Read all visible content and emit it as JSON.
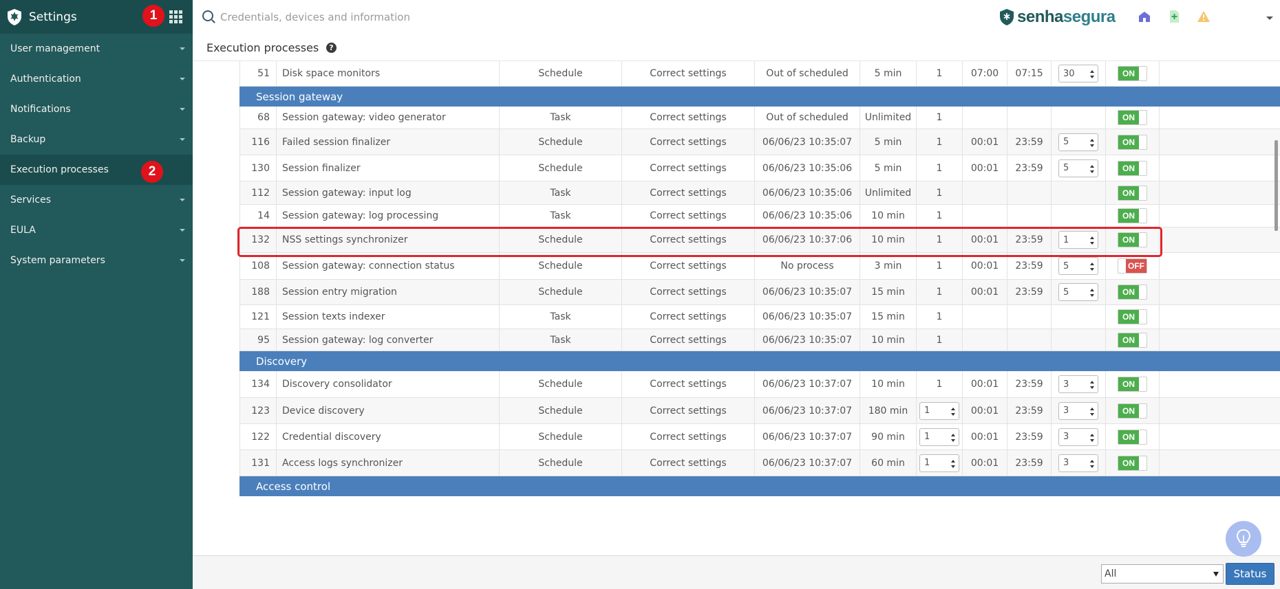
{
  "sidebar": {
    "title": "Settings",
    "badge1": "1",
    "badge2": "2",
    "items": [
      {
        "label": "User management",
        "caret": true
      },
      {
        "label": "Authentication",
        "caret": true
      },
      {
        "label": "Notifications",
        "caret": true
      },
      {
        "label": "Backup",
        "caret": true
      },
      {
        "label": "Execution processes",
        "caret": false,
        "active": true
      },
      {
        "label": "Services",
        "caret": true
      },
      {
        "label": "EULA",
        "caret": true
      },
      {
        "label": "System parameters",
        "caret": true
      }
    ]
  },
  "topbar": {
    "search_placeholder": "Credentials, devices and information",
    "brand_a": "senha",
    "brand_b": "segura"
  },
  "page": {
    "title": "Execution processes",
    "help": "?"
  },
  "table": {
    "rows": [
      {
        "kind": "row",
        "alt": false,
        "id": "51",
        "name": "Disk space monitors",
        "type": "Schedule",
        "status": "Correct settings",
        "last": "Out of scheduled",
        "interval": "5 min",
        "inst": "1",
        "inst_stepper": false,
        "start": "07:00",
        "end": "07:15",
        "num": "30",
        "toggle": "ON"
      },
      {
        "kind": "group",
        "label": "Session gateway"
      },
      {
        "kind": "row",
        "alt": false,
        "id": "68",
        "name": "Session gateway: video generator",
        "type": "Task",
        "status": "Correct settings",
        "last": "Out of scheduled",
        "interval": "Unlimited",
        "inst": "1",
        "inst_stepper": false,
        "start": "",
        "end": "",
        "num": "",
        "toggle": "ON"
      },
      {
        "kind": "row",
        "alt": true,
        "id": "116",
        "name": "Failed session finalizer",
        "type": "Schedule",
        "status": "Correct settings",
        "last": "06/06/23 10:35:07",
        "interval": "5 min",
        "inst": "1",
        "inst_stepper": false,
        "start": "00:01",
        "end": "23:59",
        "num": "5",
        "toggle": "ON"
      },
      {
        "kind": "row",
        "alt": false,
        "id": "130",
        "name": "Session finalizer",
        "type": "Schedule",
        "status": "Correct settings",
        "last": "06/06/23 10:35:06",
        "interval": "5 min",
        "inst": "1",
        "inst_stepper": false,
        "start": "00:01",
        "end": "23:59",
        "num": "5",
        "toggle": "ON"
      },
      {
        "kind": "row",
        "alt": true,
        "id": "112",
        "name": "Session gateway: input log",
        "type": "Task",
        "status": "Correct settings",
        "last": "06/06/23 10:35:06",
        "interval": "Unlimited",
        "inst": "1",
        "inst_stepper": false,
        "start": "",
        "end": "",
        "num": "",
        "toggle": "ON"
      },
      {
        "kind": "row",
        "alt": false,
        "id": "14",
        "name": "Session gateway: log processing",
        "type": "Task",
        "status": "Correct settings",
        "last": "06/06/23 10:35:06",
        "interval": "10 min",
        "inst": "1",
        "inst_stepper": false,
        "start": "",
        "end": "",
        "num": "",
        "toggle": "ON"
      },
      {
        "kind": "row",
        "alt": true,
        "id": "132",
        "name": "NSS settings synchronizer",
        "type": "Schedule",
        "status": "Correct settings",
        "last": "06/06/23 10:37:06",
        "interval": "10 min",
        "inst": "1",
        "inst_stepper": false,
        "start": "00:01",
        "end": "23:59",
        "num": "1",
        "toggle": "ON"
      },
      {
        "kind": "row",
        "alt": false,
        "id": "108",
        "name": "Session gateway: connection status",
        "type": "Schedule",
        "status": "Correct settings",
        "last": "No process",
        "interval": "3 min",
        "inst": "1",
        "inst_stepper": false,
        "start": "00:01",
        "end": "23:59",
        "num": "5",
        "toggle": "OFF"
      },
      {
        "kind": "row",
        "alt": true,
        "id": "188",
        "name": "Session entry migration",
        "type": "Schedule",
        "status": "Correct settings",
        "last": "06/06/23 10:35:07",
        "interval": "15 min",
        "inst": "1",
        "inst_stepper": false,
        "start": "00:01",
        "end": "23:59",
        "num": "5",
        "toggle": "ON"
      },
      {
        "kind": "row",
        "alt": false,
        "id": "121",
        "name": "Session texts indexer",
        "type": "Task",
        "status": "Correct settings",
        "last": "06/06/23 10:35:07",
        "interval": "15 min",
        "inst": "1",
        "inst_stepper": false,
        "start": "",
        "end": "",
        "num": "",
        "toggle": "ON"
      },
      {
        "kind": "row",
        "alt": true,
        "id": "95",
        "name": "Session gateway: log converter",
        "type": "Task",
        "status": "Correct settings",
        "last": "06/06/23 10:35:07",
        "interval": "10 min",
        "inst": "1",
        "inst_stepper": false,
        "start": "",
        "end": "",
        "num": "",
        "toggle": "ON"
      },
      {
        "kind": "group",
        "label": "Discovery"
      },
      {
        "kind": "row",
        "alt": false,
        "id": "134",
        "name": "Discovery consolidator",
        "type": "Schedule",
        "status": "Correct settings",
        "last": "06/06/23 10:37:07",
        "interval": "10 min",
        "inst": "1",
        "inst_stepper": false,
        "start": "00:01",
        "end": "23:59",
        "num": "3",
        "toggle": "ON"
      },
      {
        "kind": "row",
        "alt": true,
        "id": "123",
        "name": "Device discovery",
        "type": "Schedule",
        "status": "Correct settings",
        "last": "06/06/23 10:37:07",
        "interval": "180 min",
        "inst": "1",
        "inst_stepper": true,
        "start": "00:01",
        "end": "23:59",
        "num": "3",
        "toggle": "ON"
      },
      {
        "kind": "row",
        "alt": false,
        "id": "122",
        "name": "Credential discovery",
        "type": "Schedule",
        "status": "Correct settings",
        "last": "06/06/23 10:37:07",
        "interval": "90 min",
        "inst": "1",
        "inst_stepper": true,
        "start": "00:01",
        "end": "23:59",
        "num": "3",
        "toggle": "ON"
      },
      {
        "kind": "row",
        "alt": true,
        "id": "131",
        "name": "Access logs synchronizer",
        "type": "Schedule",
        "status": "Correct settings",
        "last": "06/06/23 10:37:07",
        "interval": "60 min",
        "inst": "1",
        "inst_stepper": true,
        "start": "00:01",
        "end": "23:59",
        "num": "3",
        "toggle": "ON"
      },
      {
        "kind": "group",
        "label": "Access control"
      }
    ]
  },
  "bottombar": {
    "filter_value": "All",
    "status_label": "Status"
  },
  "colors": {
    "sidebar_bg": "#22595a",
    "group_header": "#4a7fbc",
    "toggle_on": "#4cae4c",
    "toggle_off": "#d9534f",
    "highlight": "#e0252c",
    "badge": "#e0121b"
  }
}
